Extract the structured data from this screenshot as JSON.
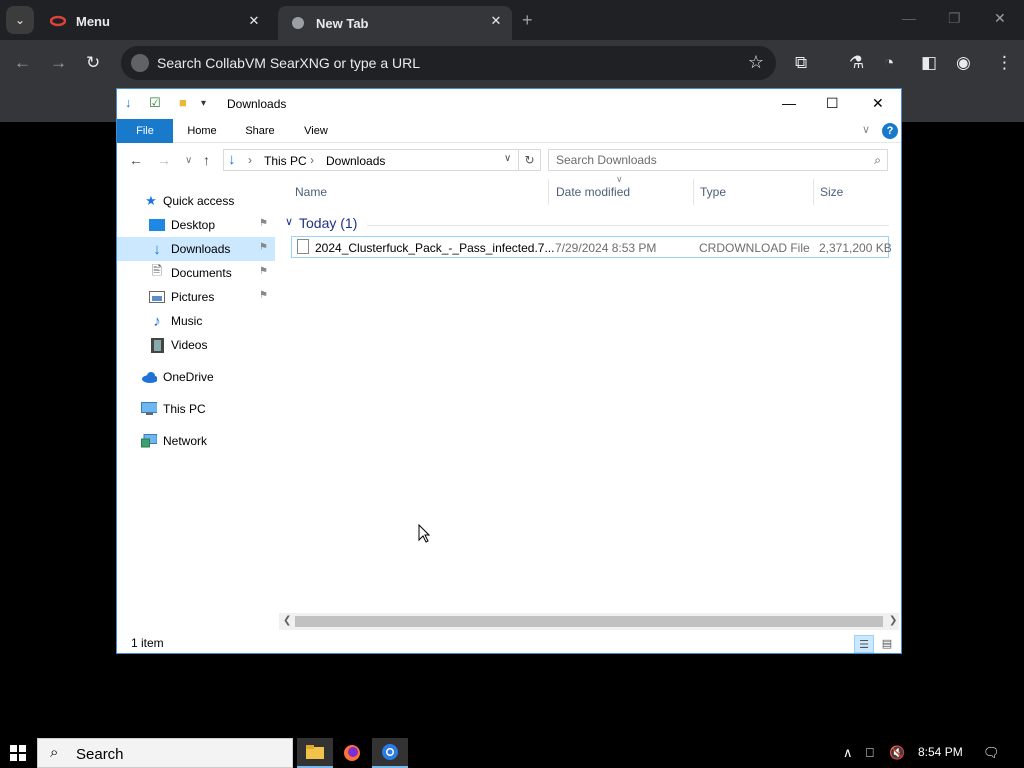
{
  "browser": {
    "tabs": [
      {
        "label": "Menu",
        "favicon": "red-logo-icon",
        "active": false
      },
      {
        "label": "New Tab",
        "favicon": "globe-icon",
        "active": true
      }
    ],
    "omnibox_placeholder": "Search CollabVM SearXNG or type a URL"
  },
  "explorer": {
    "window_title": "Downloads",
    "ribbon_tabs": [
      "File",
      "Home",
      "Share",
      "View"
    ],
    "address": {
      "root": "This PC",
      "current": "Downloads"
    },
    "search_placeholder": "Search Downloads",
    "nav_pane": [
      {
        "label": "Quick access",
        "icon": "star-icon"
      },
      {
        "label": "Desktop",
        "icon": "desktop-icon",
        "pinned": true
      },
      {
        "label": "Downloads",
        "icon": "download-arrow-icon",
        "pinned": true,
        "selected": true
      },
      {
        "label": "Documents",
        "icon": "document-icon",
        "pinned": true
      },
      {
        "label": "Pictures",
        "icon": "pictures-icon",
        "pinned": true
      },
      {
        "label": "Music",
        "icon": "music-note-icon"
      },
      {
        "label": "Videos",
        "icon": "film-icon"
      },
      {
        "label": "OneDrive",
        "icon": "cloud-icon"
      },
      {
        "label": "This PC",
        "icon": "monitor-icon"
      },
      {
        "label": "Network",
        "icon": "network-icon"
      }
    ],
    "columns": {
      "name": "Name",
      "date": "Date modified",
      "type": "Type",
      "size": "Size"
    },
    "group_header": "Today (1)",
    "files": [
      {
        "name": "2024_Clusterfuck_Pack_-_Pass_infected.7...",
        "date": "7/29/2024 8:53 PM",
        "type": "CRDOWNLOAD File",
        "size": "2,371,200 KB"
      }
    ],
    "status": "1 item"
  },
  "taskbar": {
    "search_label": "Search",
    "clock": "8:54 PM"
  }
}
